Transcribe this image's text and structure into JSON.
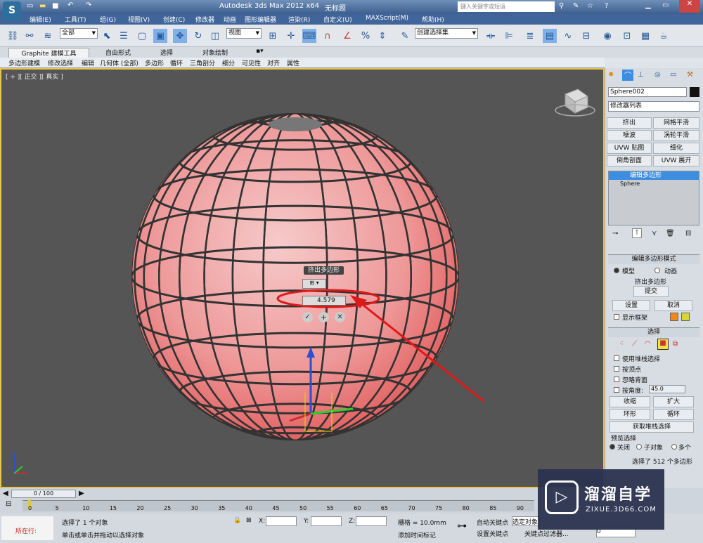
{
  "title": {
    "app": "Autodesk 3ds Max  2012 x64",
    "doc": "无标题",
    "search_placeholder": "键入关键字或短语"
  },
  "menu": [
    "编辑(E)",
    "工具(T)",
    "组(G)",
    "视图(V)",
    "创建(C)",
    "修改器",
    "动画",
    "图形编辑器",
    "渲染(R)",
    "自定义(U)",
    "MAXScript(M)",
    "帮助(H)"
  ],
  "toolbar": {
    "selection_filter": "全部",
    "ref_coord": "视图",
    "named_selection": "创建选择集"
  },
  "ribbon": {
    "tabs": [
      "Graphite 建模工具",
      "自由形式",
      "选择",
      "对象绘制"
    ]
  },
  "subribbon": [
    "多边形建模",
    "修改选择",
    "编辑",
    "几何体 (全部)",
    "多边形",
    "循环",
    "三角剖分",
    "细分",
    "可见性",
    "对齐",
    "属性"
  ],
  "viewport": {
    "label": "[ + ][ 正交 ][ 真实 ]",
    "caddy_title": "挤出多边形",
    "caddy_value": "4.579"
  },
  "panel": {
    "object_name": "Sphere002",
    "modifier_list": "修改器列表",
    "mod_buttons": [
      "挤出",
      "网格平滑",
      "噪波",
      "涡轮平滑",
      "UVW 贴图",
      "细化",
      "倒角剖面",
      "UVW 展开"
    ],
    "stack": [
      "编辑多边形",
      "Sphere"
    ],
    "mode_rollout": {
      "title": "编辑多边形模式",
      "model": "模型",
      "animate": "动画",
      "op": "挤出多边形",
      "commit": "提交",
      "settings": "设置",
      "cancel": "取消",
      "show_cage": "显示框架"
    },
    "select_rollout": {
      "title": "选择",
      "by_stack": "使用堆栈选择",
      "by_vertex": "按顶点",
      "ignore_back": "忽略背面",
      "by_angle": "按角度:",
      "angle": "45.0",
      "shrink": "收缩",
      "grow": "扩大",
      "ring": "环形",
      "loop": "循环",
      "get_stack": "获取堆栈选择",
      "preview": "预览选择",
      "off": "关闭",
      "subobj": "子对象",
      "multi": "多个",
      "status": "选择了 512 个多边形"
    }
  },
  "timeline": {
    "frame": "0 / 100",
    "ticks": [
      "0",
      "5",
      "10",
      "15",
      "20",
      "25",
      "30",
      "35",
      "40",
      "45",
      "50",
      "55",
      "60",
      "65",
      "70",
      "75",
      "80",
      "85",
      "90"
    ]
  },
  "status": {
    "running": "所在行:",
    "selected": "选择了 1 个对象",
    "prompt": "单击或单击并拖动以选择对象",
    "x": "X:",
    "y": "Y:",
    "z": "Z:",
    "grid": "栅格 = 10.0mm",
    "auto_key": "自动关键点",
    "sel_obj": "选定对象",
    "set_key": "设置关键点",
    "key_filters": "关键点过滤器...",
    "add_time_tag": "添加时间标记",
    "frame_input": "0"
  },
  "watermark": {
    "brand": "溜溜自学",
    "url": "ZIXUE.3D66.COM"
  },
  "colors": {
    "sphere": "#e87a7a",
    "arrow": "#e01818",
    "viewport_bg": "#555555",
    "highlight": "#3d8ee0"
  }
}
